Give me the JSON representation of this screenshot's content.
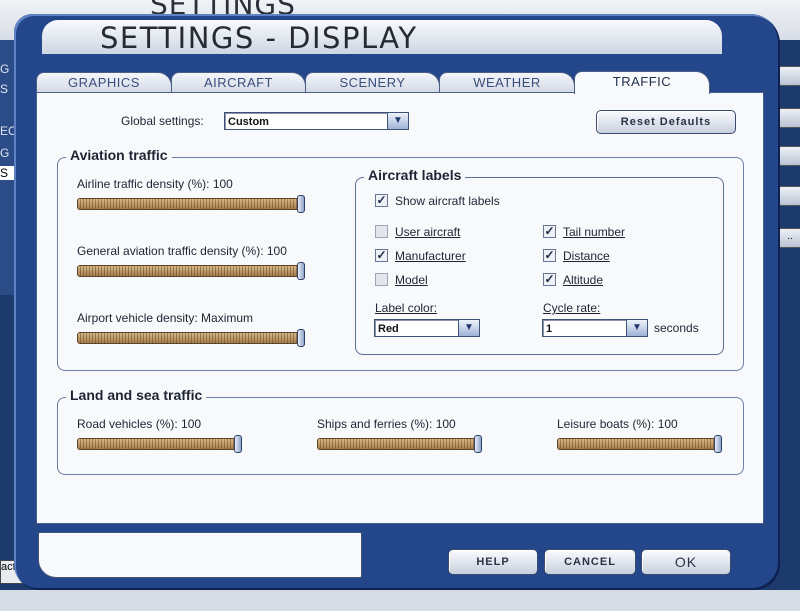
{
  "background": {
    "title": "SETTINGS",
    "left_labels": [
      "G",
      "S",
      "EC",
      "G",
      "S"
    ],
    "bottom_tab": "acts",
    "right_button_label": ".."
  },
  "title": "SETTINGS - DISPLAY",
  "tabs": [
    {
      "label": "GRAPHICS"
    },
    {
      "label": "AIRCRAFT"
    },
    {
      "label": "SCENERY"
    },
    {
      "label": "WEATHER"
    },
    {
      "label": "TRAFFIC",
      "active": true
    }
  ],
  "global": {
    "label": "Global settings:",
    "value": "Custom"
  },
  "reset_button": "Reset Defaults",
  "aviation": {
    "title": "Aviation traffic",
    "airline": {
      "label": "Airline traffic density (%): 100",
      "value": 100
    },
    "general": {
      "label": "General aviation traffic density (%): 100",
      "value": 100
    },
    "vehicle": {
      "label": "Airport vehicle density: Maximum",
      "value": 100
    }
  },
  "aircraft_labels": {
    "title": "Aircraft labels",
    "show": {
      "label": "Show aircraft labels",
      "checked": true
    },
    "user_aircraft": {
      "label": "User aircraft",
      "checked": false
    },
    "manufacturer": {
      "label": "Manufacturer",
      "checked": true
    },
    "model": {
      "label": "Model",
      "checked": false
    },
    "tail_number": {
      "label": "Tail number",
      "checked": true
    },
    "distance": {
      "label": "Distance",
      "checked": true
    },
    "altitude": {
      "label": "Altitude",
      "checked": true
    },
    "label_color": {
      "label": "Label color:",
      "value": "Red"
    },
    "cycle_rate": {
      "label": "Cycle rate:",
      "value": "1",
      "unit": "seconds"
    }
  },
  "land_sea": {
    "title": "Land and sea traffic",
    "road": {
      "label": "Road vehicles (%): 100",
      "value": 100
    },
    "ships": {
      "label": "Ships and ferries (%): 100",
      "value": 100
    },
    "leisure": {
      "label": "Leisure boats (%): 100",
      "value": 100
    }
  },
  "buttons": {
    "help": "HELP",
    "cancel": "CANCEL",
    "ok": "OK"
  },
  "colors": {
    "frame": "#24468a",
    "panel": "#f8f9fb",
    "slider": "#c49a63"
  }
}
